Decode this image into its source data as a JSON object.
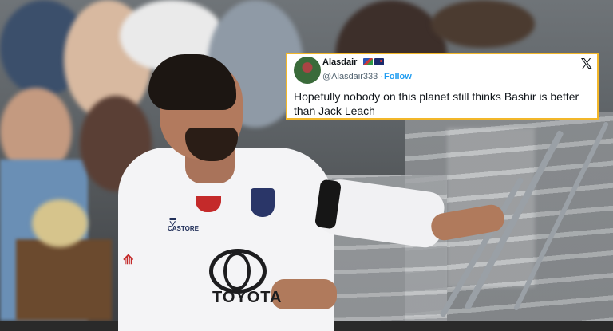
{
  "tweet": {
    "author_name": "Alasdair",
    "handle": "@Alasdair333",
    "separator": "·",
    "follow_label": "Follow",
    "text": "Hopefully nobody on this planet still thinks Bashir is better than Jack Leach",
    "platform_icon": "x-logo-icon",
    "avatar_icon": "profile-avatar",
    "flags": [
      "namibia-flag-icon",
      "new-zealand-flag-icon"
    ]
  },
  "photo": {
    "jersey_sponsor": "TOYOTA",
    "jersey_brand": "CASTORE",
    "colors": {
      "jersey": "#f4f4f6",
      "accent_red": "#c42a2a",
      "card_border": "#f2b72a",
      "follow_blue": "#1d9bf0"
    }
  }
}
